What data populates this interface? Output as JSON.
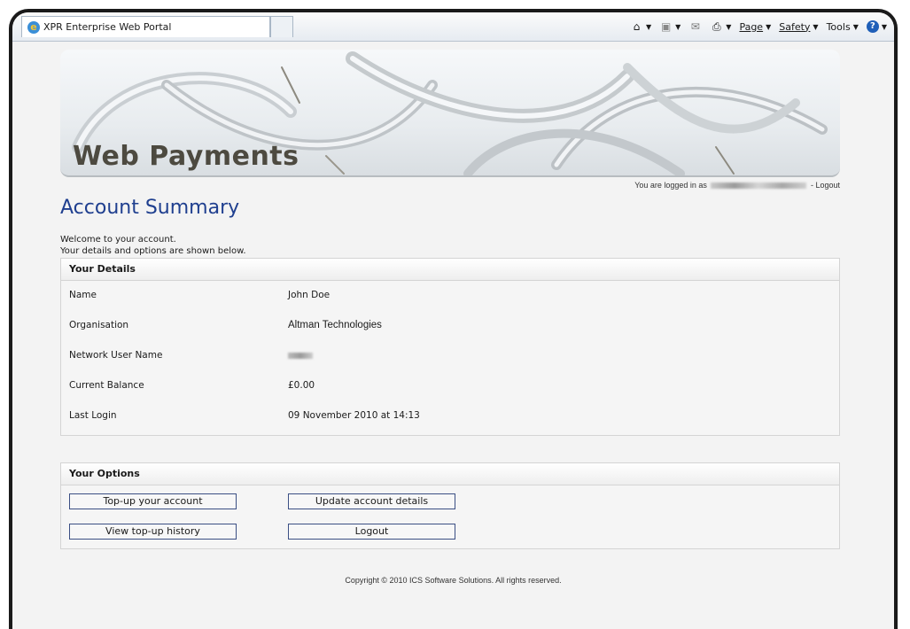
{
  "browser": {
    "tab_title": "XPR Enterprise Web Portal",
    "commands": {
      "page": "Page",
      "safety": "Safety",
      "tools": "Tools"
    }
  },
  "banner": {
    "title": "Web Payments"
  },
  "session": {
    "logged_in_prefix": "You are logged in as",
    "logout_link": "- Logout"
  },
  "heading": "Account Summary",
  "welcome": {
    "line1": "Welcome to your account.",
    "line2": "Your details and options are shown below."
  },
  "details": {
    "title": "Your Details",
    "rows": [
      {
        "label": "Name",
        "value": "John Doe"
      },
      {
        "label": "Organisation",
        "value": "Altman Technologies"
      },
      {
        "label": "Network User Name",
        "value": ""
      },
      {
        "label": "Current Balance",
        "value": "£0.00"
      },
      {
        "label": "Last Login",
        "value": "09 November 2010 at 14:13"
      }
    ]
  },
  "options": {
    "title": "Your Options",
    "buttons": {
      "topup": "Top-up your account",
      "update": "Update account details",
      "history": "View top-up history",
      "logout": "Logout"
    }
  },
  "footer": "Copyright © 2010 ICS Software Solutions. All rights reserved."
}
